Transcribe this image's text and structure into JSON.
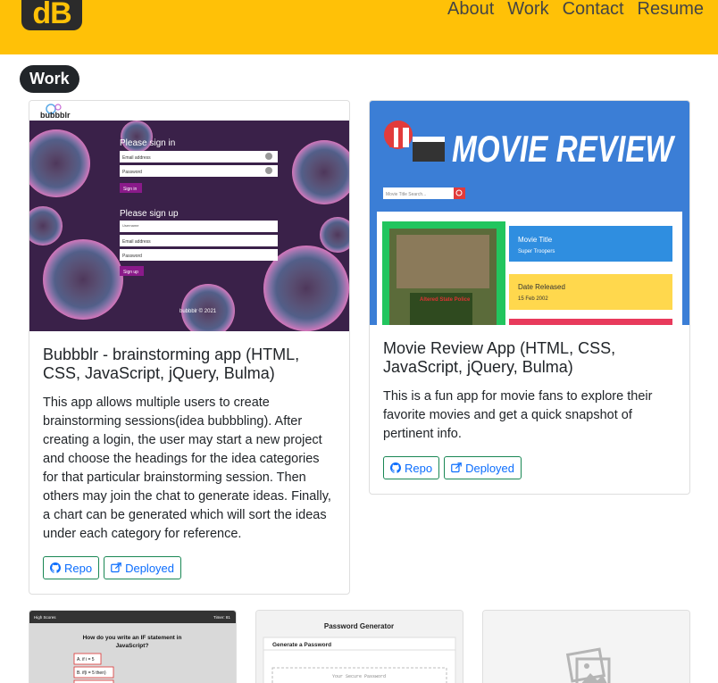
{
  "header": {
    "logo_text": "dB",
    "nav": [
      {
        "label": "About"
      },
      {
        "label": "Work"
      },
      {
        "label": "Contact"
      },
      {
        "label": "Resume"
      }
    ]
  },
  "section": {
    "title": "Work"
  },
  "projects": [
    {
      "title": "Bubbblr - brainstorming app (HTML, CSS, JavaScript, jQuery, Bulma)",
      "description": "This app allows multiple users to create brainstorming sessions(idea bubbbling). After creating a login, the user may start a new project and choose the headings for the idea categories for that particular brainstorming session. Then others may join the chat to generate ideas. Finally, a chart can be generated which will sort the ideas under each category for reference.",
      "repo_label": "Repo",
      "deployed_label": "Deployed",
      "screenshot": {
        "brand": "bubbblr",
        "signin_heading": "Please sign in",
        "signin_email": "Email address",
        "signin_password": "Password",
        "signin_button": "Sign in",
        "signup_heading": "Please sign up",
        "signup_username": "Username",
        "signup_email": "Email address",
        "signup_password": "Password",
        "signup_button": "Sign up",
        "footer": "bubbblr © 2021"
      }
    },
    {
      "title": "Movie Review App (HTML, CSS, JavaScript, jQuery, Bulma)",
      "description": "This is a fun app for movie fans to explore their favorite movies and get a quick snapshot of pertinent info.",
      "repo_label": "Repo",
      "deployed_label": "Deployed",
      "screenshot": {
        "banner": "MOVIE REVIEW",
        "search_placeholder": "Movie Title Search...",
        "poster_text": "Altered State Police",
        "info1_label": "Movie Title",
        "info1_value": "Super Troopers",
        "info2_label": "Date Released",
        "info2_value": "15 Feb 2002"
      }
    },
    {
      "screenshot": {
        "left_label": "High Scores",
        "right_label": "Timer: 81",
        "question_line1": "How do you write an IF statement in",
        "question_line2": "JavaScript?",
        "answer1": "A. if i = 5",
        "answer2": "B. if(i = 5 then)"
      }
    },
    {
      "screenshot": {
        "heading": "Password Generator",
        "subheading": "Generate a Password",
        "field_placeholder": "Your Secure Password"
      }
    },
    {
      "screenshot": {
        "placeholder_icon": "image-placeholder-icon"
      }
    }
  ],
  "colors": {
    "header_bg": "#ffc107",
    "button_border": "#198754",
    "button_text": "#0d6efd",
    "pill_bg": "#212529"
  }
}
